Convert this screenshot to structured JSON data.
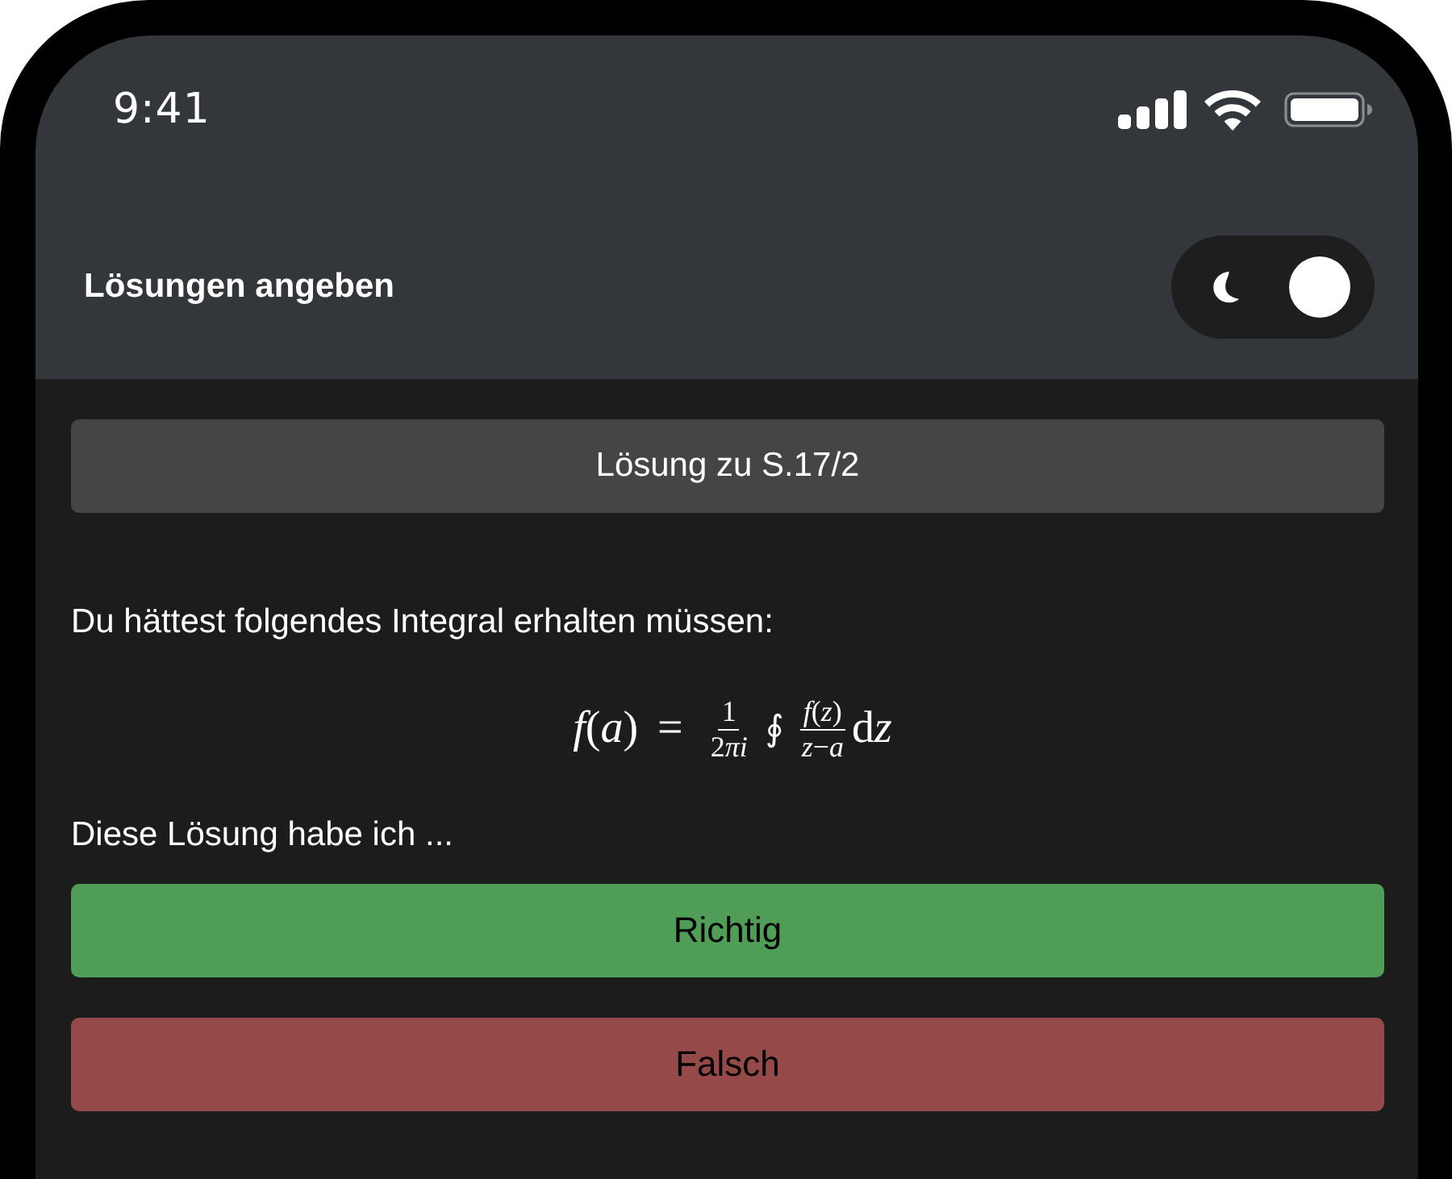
{
  "status_bar": {
    "time": "9:41"
  },
  "header": {
    "title": "Lösungen angeben",
    "dark_mode_toggle": {
      "on": true
    }
  },
  "solution_button": {
    "label": "Lösung zu S.17/2"
  },
  "prompt": "Du hättest folgendes Integral erhalten müssen:",
  "formula": [
    {
      "kind": "italic",
      "text": "f"
    },
    {
      "kind": "upright",
      "text": "("
    },
    {
      "kind": "italic",
      "text": "a"
    },
    {
      "kind": "upright",
      "text": ")"
    },
    {
      "kind": "relation",
      "text": "="
    },
    {
      "kind": "frac",
      "num": [
        {
          "kind": "upright",
          "text": "1"
        }
      ],
      "den": [
        {
          "kind": "upright",
          "text": "2"
        },
        {
          "kind": "italic",
          "text": "πi"
        }
      ]
    },
    {
      "kind": "integral",
      "text": "∮"
    },
    {
      "kind": "frac",
      "num": [
        {
          "kind": "italic",
          "text": "f"
        },
        {
          "kind": "upright",
          "text": "("
        },
        {
          "kind": "italic",
          "text": "z"
        },
        {
          "kind": "upright",
          "text": ")"
        }
      ],
      "den": [
        {
          "kind": "italic",
          "text": "z"
        },
        {
          "kind": "upright",
          "text": "−"
        },
        {
          "kind": "italic",
          "text": "a"
        }
      ]
    },
    {
      "kind": "upright",
      "text": "d"
    },
    {
      "kind": "italic",
      "text": "z"
    }
  ],
  "question": "Diese Lösung habe ich ...",
  "answer_buttons": [
    {
      "label": "Richtig",
      "color": "#4f9d57"
    },
    {
      "label": "Falsch",
      "color": "#964949"
    }
  ]
}
